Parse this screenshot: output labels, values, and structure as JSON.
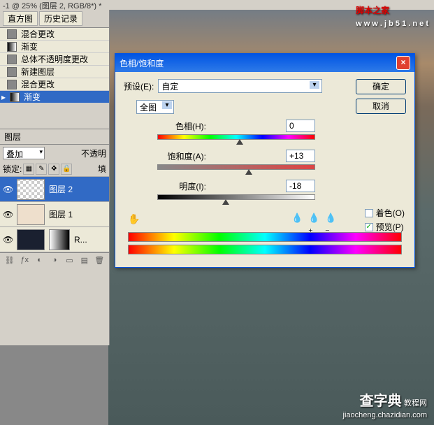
{
  "title_bar": "-1 @ 25% (图层 2, RGB/8*) *",
  "watermark": {
    "top_text": "脚本之家",
    "top_url": "w w w . j b 5 1 . n e t",
    "bottom_text": "查字典",
    "bottom_sub": "教程网",
    "bottom_url": "jiaocheng.chazidian.com"
  },
  "panel": {
    "tabs": [
      "直方图",
      "历史记录"
    ],
    "history": [
      {
        "label": "混合更改"
      },
      {
        "label": "渐变",
        "gradient": true
      },
      {
        "label": "总体不透明度更改"
      },
      {
        "label": "新建图层"
      },
      {
        "label": "混合更改"
      },
      {
        "label": "渐变",
        "gradient": true,
        "selected": true
      }
    ]
  },
  "layers": {
    "title": "图层",
    "blend_mode": "叠加",
    "opacity_label": "不透明",
    "lock_label": "锁定:",
    "fill_label": "填",
    "items": [
      {
        "name": "图层 2",
        "selected": true
      },
      {
        "name": "图层 1"
      },
      {
        "name": "R..."
      }
    ]
  },
  "dialog": {
    "title": "色相/饱和度",
    "preset_label": "预设(E):",
    "preset_value": "自定",
    "ok": "确定",
    "cancel": "取消",
    "channel": "全图",
    "sliders": {
      "hue": {
        "label": "色相(H):",
        "value": "0",
        "pos": 50
      },
      "saturation": {
        "label": "饱和度(A):",
        "value": "+13",
        "pos": 56
      },
      "lightness": {
        "label": "明度(I):",
        "value": "-18",
        "pos": 41
      }
    },
    "colorize": "着色(O)",
    "preview": "预览(P)",
    "preview_checked": true
  }
}
